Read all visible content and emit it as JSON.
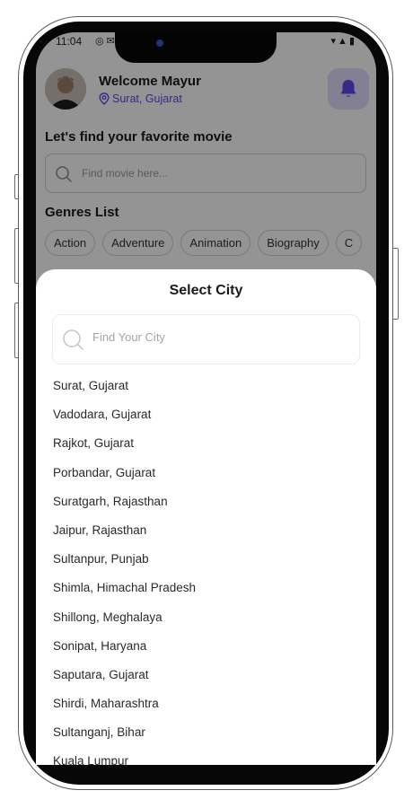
{
  "status_bar": {
    "time": "11:04",
    "left_icons": "◎✉▲",
    "right_icons": "▾▲▮"
  },
  "header": {
    "welcome": "Welcome Mayur",
    "location": "Surat, Gujarat"
  },
  "search_section": {
    "title": "Let's find your favorite movie",
    "placeholder": "Find movie here..."
  },
  "genres": {
    "title": "Genres List",
    "items": [
      "Action",
      "Adventure",
      "Animation",
      "Biography",
      "C"
    ]
  },
  "city_sheet": {
    "title": "Select City",
    "search_placeholder": "Find Your City",
    "cities": [
      "Surat, Gujarat",
      "Vadodara, Gujarat",
      "Rajkot, Gujarat",
      "Porbandar, Gujarat",
      "Suratgarh, Rajasthan",
      "Jaipur, Rajasthan",
      "Sultanpur, Punjab",
      "Shimla, Himachal Pradesh",
      "Shillong, Meghalaya",
      "Sonipat, Haryana",
      "Saputara, Gujarat",
      "Shirdi, Maharashtra",
      "Sultanganj, Bihar",
      "Kuala Lumpur"
    ]
  },
  "colors": {
    "accent": "#5a49e8",
    "bell_bg": "#e2dcff",
    "overlay": "rgba(0,0,0,0.42)"
  }
}
